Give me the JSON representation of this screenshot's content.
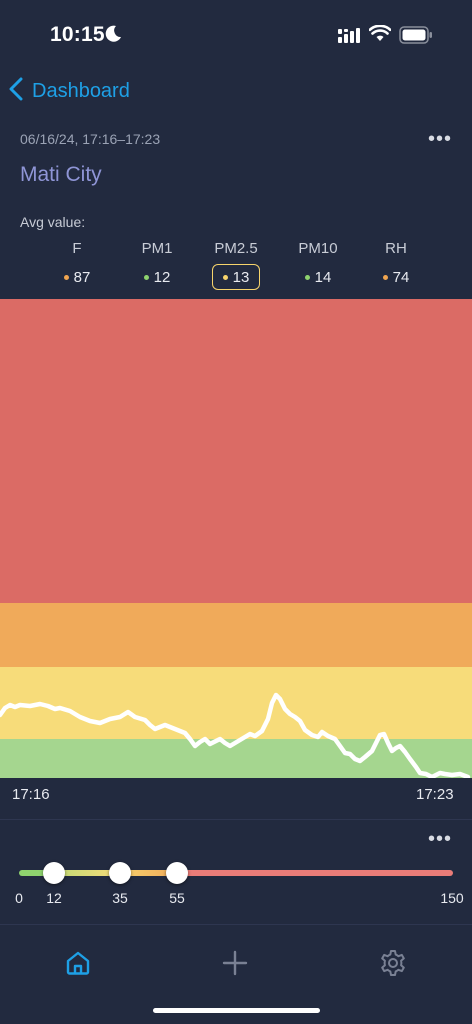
{
  "status": {
    "time": "10:15",
    "icons": [
      "moon-icon",
      "signal-icon",
      "wifi-icon",
      "battery-icon"
    ]
  },
  "nav": {
    "back_label": "Dashboard",
    "back_icon": "chevron-left-icon"
  },
  "header": {
    "date_range": "06/16/24, 17:16–17:23",
    "more_label": "•••",
    "location": "Mati City",
    "avg_label": "Avg value:"
  },
  "metrics": [
    {
      "name": "F",
      "value": "87",
      "dot": "#f0a550",
      "selected": false
    },
    {
      "name": "PM1",
      "value": "12",
      "dot": "#8fd36e",
      "selected": false
    },
    {
      "name": "PM2.5",
      "value": "13",
      "dot": "#f7d46c",
      "selected": true
    },
    {
      "name": "PM10",
      "value": "14",
      "dot": "#8fd36e",
      "selected": false
    },
    {
      "name": "RH",
      "value": "74",
      "dot": "#f0a550",
      "selected": false
    }
  ],
  "chart": {
    "time_start": "17:16",
    "time_end": "17:23"
  },
  "scale": {
    "more_label": "•••",
    "min": "0",
    "thresholds": [
      "12",
      "35",
      "55"
    ],
    "max": "150"
  },
  "colors": {
    "background": "#222a3f",
    "accent": "#1ea0e6",
    "good": "#a5d68f",
    "moderate": "#f7dc7a",
    "unhealthy_sensitive": "#f0aa5a",
    "unhealthy": "#db6b65"
  },
  "tabs": [
    {
      "name": "tab-home",
      "icon": "home-icon",
      "active": true
    },
    {
      "name": "tab-add",
      "icon": "plus-icon",
      "active": false
    },
    {
      "name": "tab-settings",
      "icon": "gear-icon",
      "active": false
    }
  ]
}
